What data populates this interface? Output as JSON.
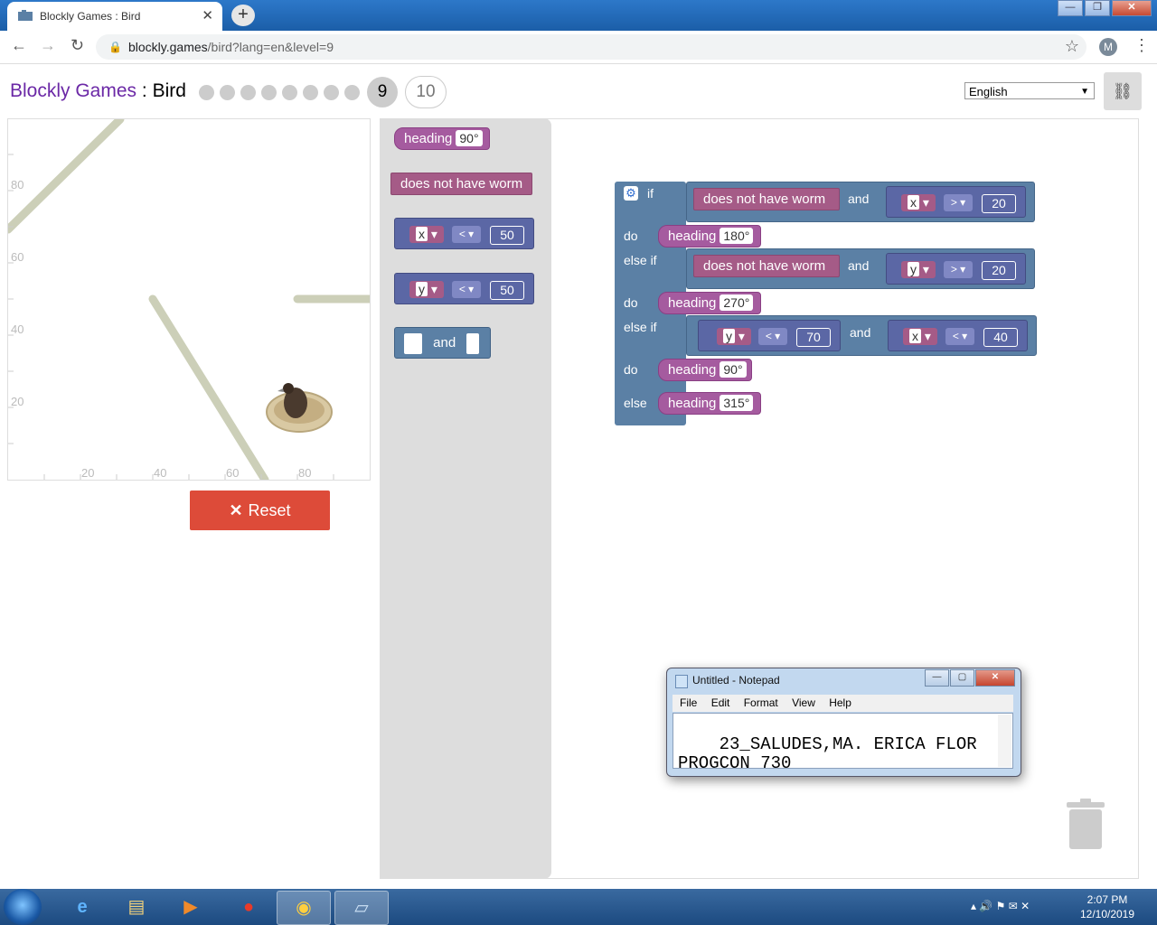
{
  "browser": {
    "tab_title": "Blockly Games : Bird",
    "tab_close": "✕",
    "new_tab": "+",
    "url_host": "blockly.games",
    "url_path": "/bird?lang=en&level=9",
    "avatar_initial": "M",
    "window_minimize": "—",
    "window_restore": "❐",
    "window_close": "✕"
  },
  "header": {
    "brand": "Blockly Games",
    "separator": " : ",
    "game": "Bird",
    "current_level": "9",
    "next_level": "10",
    "completed_levels": 8,
    "language": "English"
  },
  "viz": {
    "x_ticks": [
      "20",
      "40",
      "60",
      "80"
    ],
    "y_ticks": [
      "80",
      "60",
      "40",
      "20"
    ]
  },
  "reset_label": "Reset",
  "flyout": {
    "heading_label": "heading",
    "heading_value": "90°",
    "worm_label": "does not have worm",
    "cmp1": {
      "var": "x",
      "op": "<",
      "num": "50"
    },
    "cmp2": {
      "var": "y",
      "op": "<",
      "num": "50"
    },
    "and_label": "and"
  },
  "program": {
    "if": "if",
    "do": "do",
    "else_if": "else if",
    "else": "else",
    "and": "and",
    "heading": "heading",
    "worm": "does not have worm",
    "cond1": {
      "var": "x",
      "op": ">",
      "num": "20"
    },
    "cond2": {
      "var": "y",
      "op": ">",
      "num": "20"
    },
    "cond3a": {
      "var": "y",
      "op": "<",
      "num": "70"
    },
    "cond3b": {
      "var": "x",
      "op": "<",
      "num": "40"
    },
    "h1": "180°",
    "h2": "270°",
    "h3": "90°",
    "h4": "315°"
  },
  "notepad": {
    "title": "Untitled - Notepad",
    "menu": [
      "File",
      "Edit",
      "Format",
      "View",
      "Help"
    ],
    "text": "23_SALUDES,MA. ERICA FLOR PROGCON 730"
  },
  "taskbar": {
    "time": "2:07 PM",
    "date": "12/10/2019"
  },
  "colors": {
    "brand": "#6b28a6",
    "reset": "#dd4b39",
    "heading_block": "#a55b9f",
    "logic_block": "#5b80a5",
    "compare_block": "#5b67a5",
    "worm_block": "#a55b87"
  }
}
